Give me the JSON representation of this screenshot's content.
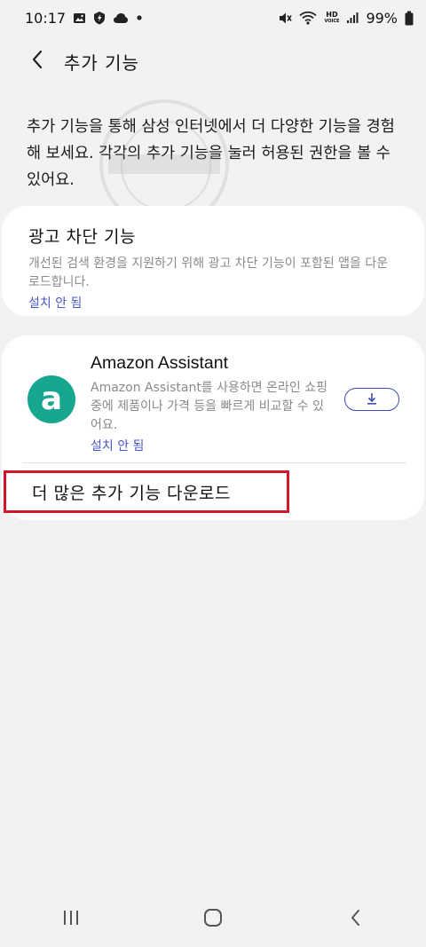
{
  "status_bar": {
    "time": "10:17",
    "left_icons": [
      "gallery-icon",
      "shield-icon",
      "cloud-icon",
      "dot-icon"
    ],
    "right_icons": [
      "mute-icon",
      "wifi-icon",
      "hd-voice-icon",
      "signal-icon",
      "battery-icon"
    ],
    "hd_label_top": "HD",
    "hd_label_bottom": "VOICE",
    "battery": "99%"
  },
  "header": {
    "title": "추가 기능",
    "back_icon": "back-arrow-icon"
  },
  "intro": {
    "text": "추가 기능을 통해 삼성 인터넷에서 더 다양한 기능을 경험해 보세요. 각각의 추가 기능을 눌러 허용된 권한을 볼 수 있어요."
  },
  "ad_block": {
    "title": "광고 차단 기능",
    "description": "개선된 검색 환경을 지원하기 위해 광고 차단 기능이 포함된 앱을 다운로드합니다.",
    "status": "설치 안 됨"
  },
  "extensions": [
    {
      "logo_letter": "a",
      "name": "Amazon Assistant",
      "description": "Amazon Assistant를 사용하면 온라인 쇼핑 중에 제품이나 가격 등을 빠르게 비교할 수 있어요.",
      "status": "설치 안 됨",
      "button_icon": "download-icon",
      "logo_color": "#17a78f"
    }
  ],
  "more_downloads": {
    "label": "더 많은 추가 기능 다운로드",
    "highlight_color": "#d01729"
  },
  "nav_bar": {
    "recents_icon": "recents-icon",
    "home_icon": "home-icon",
    "back_icon": "back-icon"
  },
  "colors": {
    "background": "#f2f2f2",
    "card": "#ffffff",
    "status_link": "#4a57c7",
    "accent_button": "#3d4ab8"
  }
}
